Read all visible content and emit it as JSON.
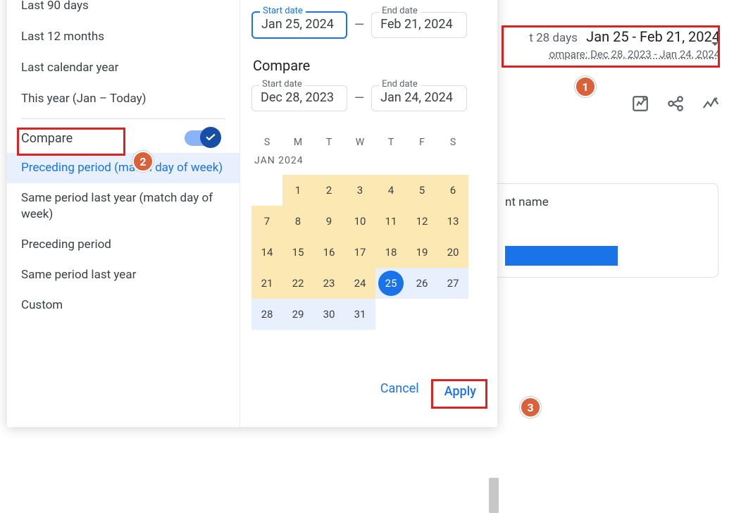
{
  "header": {
    "range_prefix": "t 28 days",
    "range_dates": "Jan 25 - Feb 21, 2024",
    "compare_line": "ompare: Dec 28, 2023 - Jan 24, 2024"
  },
  "content_label": "nt name",
  "presets": {
    "last_90": "Last 90 days",
    "last_12m": "Last 12 months",
    "last_cal": "Last calendar year",
    "this_year": "This year (Jan – Today)"
  },
  "compare": {
    "label": "Compare",
    "opts": {
      "preceding_dow": "Preceding period (match day of week)",
      "same_ly_dow": "Same period last year (match day of week)",
      "preceding": "Preceding period",
      "same_ly": "Same period last year",
      "custom": "Custom"
    }
  },
  "dates": {
    "start_label": "Start date",
    "end_label": "End date",
    "start_value": "Jan 25, 2024",
    "end_value": "Feb 21, 2024",
    "compare_title": "Compare",
    "cmp_start": "Dec 28, 2023",
    "cmp_end": "Jan 24, 2024"
  },
  "calendar": {
    "days_of_week": {
      "su": "S",
      "mo": "M",
      "tu": "T",
      "we": "W",
      "th": "T",
      "fr": "F",
      "sa": "S"
    },
    "month_label": "JAN 2024"
  },
  "footer": {
    "cancel": "Cancel",
    "apply": "Apply"
  },
  "anno": {
    "a1": "1",
    "a2": "2",
    "a3": "3"
  }
}
